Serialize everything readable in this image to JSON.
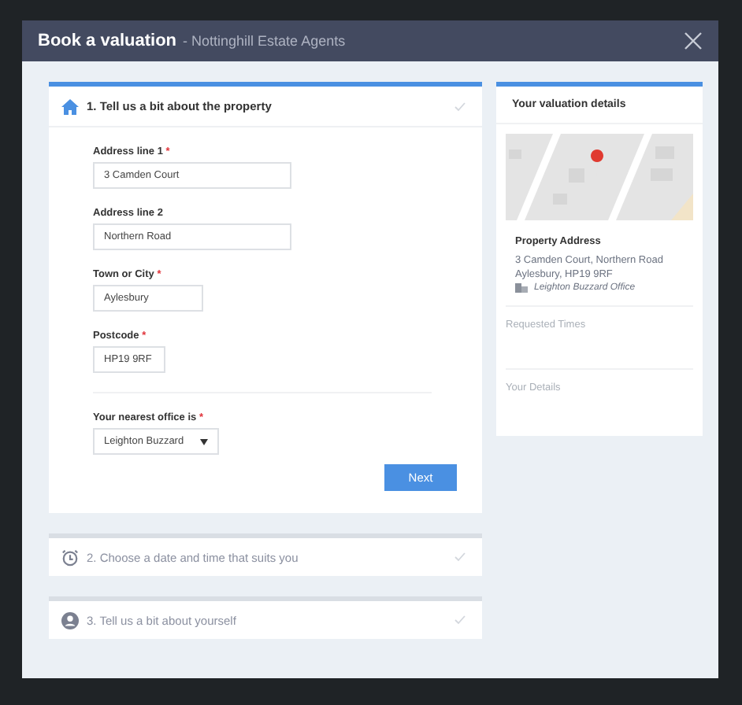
{
  "modal": {
    "title": "Book a valuation",
    "subtitle": "- Nottinghill Estate Agents"
  },
  "steps": [
    {
      "label": "1. Tell us a bit about the property",
      "expanded": true,
      "fields": [
        {
          "kind": "text",
          "label": "Address line 1",
          "required_mark": "*",
          "value": "3 Camden Court"
        },
        {
          "kind": "text",
          "label": "Address line 2",
          "value": "Northern Road"
        },
        {
          "kind": "text",
          "label": "Town or City",
          "required_mark": "*",
          "value": "Aylesbury"
        },
        {
          "kind": "text",
          "label": "Postcode",
          "required_mark": "*",
          "value": "HP19 9RF"
        },
        {
          "kind": "select",
          "label": "Your nearest office is",
          "required_mark": "*",
          "value": "Leighton Buzzard"
        }
      ],
      "button": "Next"
    },
    {
      "label": "2. Choose a date and time that suits you",
      "expanded": false
    },
    {
      "label": "3. Tell us a bit about yourself",
      "expanded": false
    }
  ],
  "details": {
    "title": "Your valuation details",
    "address_heading": "Property Address",
    "address_line_1": "3 Camden Court, Northern Road",
    "address_line_2": "Aylesbury, HP19 9RF",
    "office": "Leighton Buzzard Office",
    "requested_times": "Requested Times",
    "your_details": "Your Details"
  }
}
